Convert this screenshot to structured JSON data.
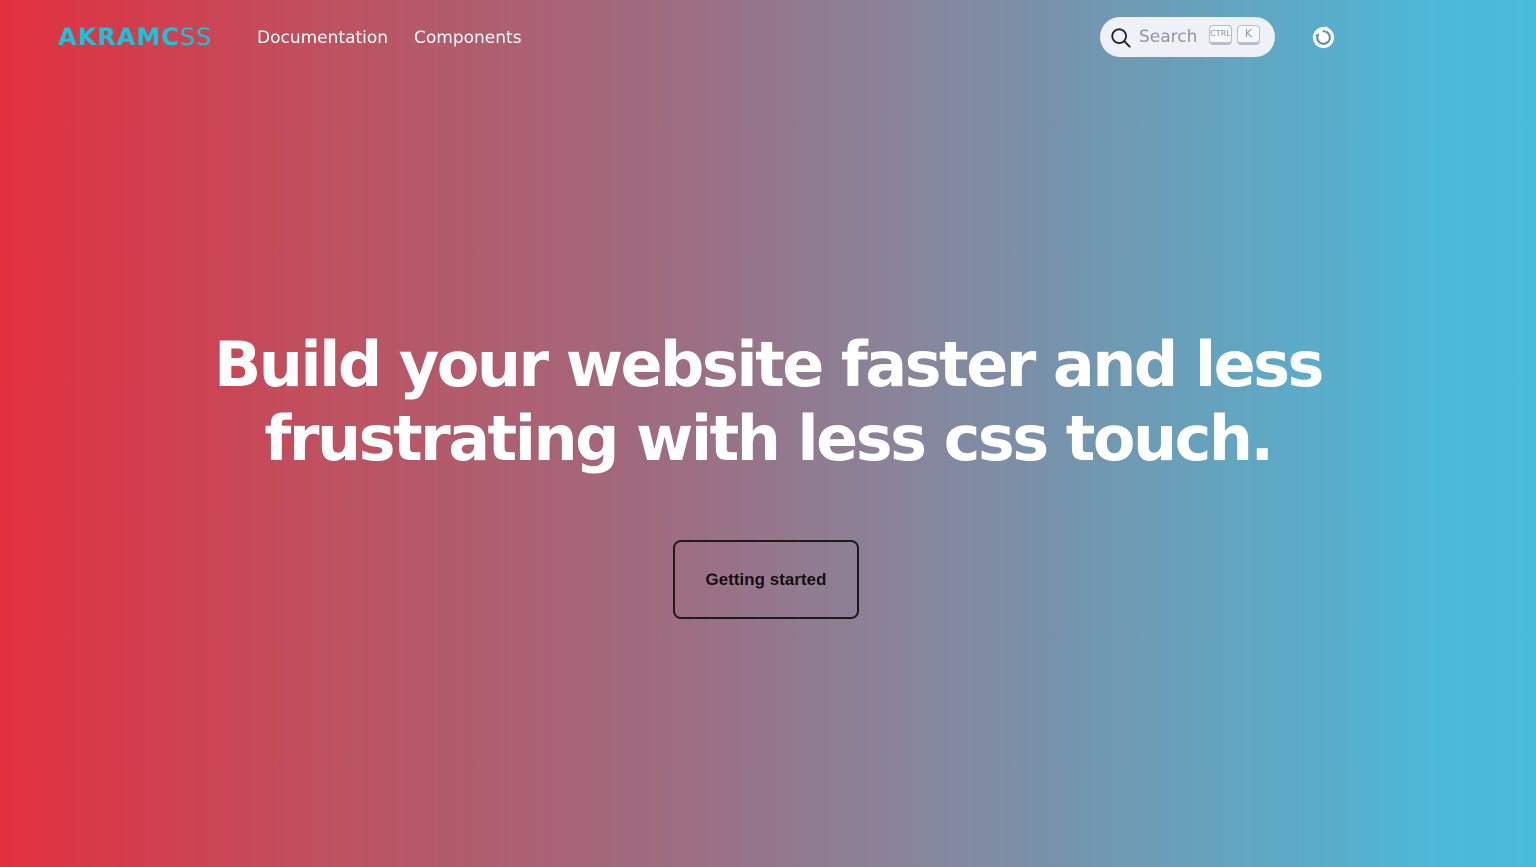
{
  "header": {
    "logo_bold": "AKRAMC",
    "logo_thin": "SS",
    "nav": {
      "documentation": "Documentation",
      "components": "Components"
    },
    "search": {
      "placeholder": "Search",
      "shortcut_ctrl": "CTRL",
      "shortcut_key": "K",
      "icon": "search-icon"
    },
    "theme_toggle_icon": "theme-toggle-icon"
  },
  "hero": {
    "title_line1": "Build your website faster and less",
    "title_line2": "frustrating with less css touch.",
    "cta_label": "Getting started"
  },
  "colors": {
    "logo": "#14c6dc",
    "gradient_start": "#e2303f",
    "gradient_end": "#49bcdc",
    "text": "#ffffff"
  }
}
